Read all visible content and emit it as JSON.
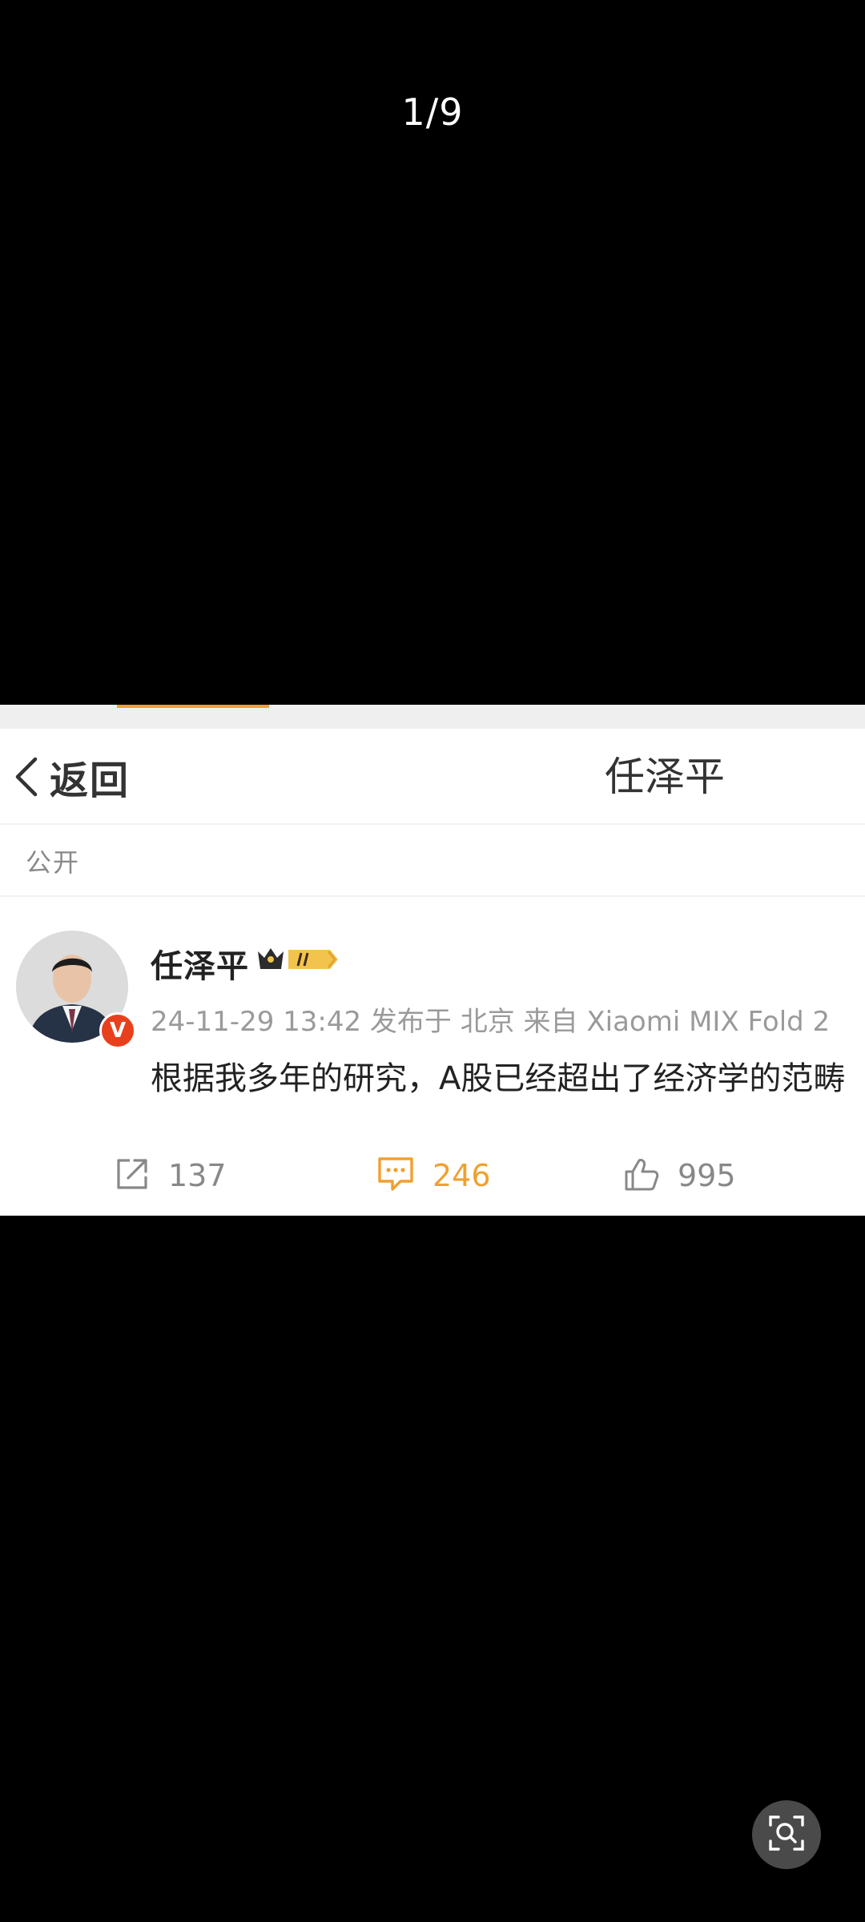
{
  "viewer": {
    "page_counter": "1/9"
  },
  "nav": {
    "back_label": "返回",
    "title": "任泽平"
  },
  "visibility": {
    "label": "公开"
  },
  "post": {
    "author": "任泽平",
    "verified_badge": "V",
    "meta": "24-11-29 13:42 发布于 北京 来自 Xiaomi MIX Fold 2",
    "text": "根据我多年的研究，A股已经超出了经济学的范畴",
    "actions": {
      "repost_count": "137",
      "comment_count": "246",
      "like_count": "995"
    }
  },
  "colors": {
    "accent": "#f0a030",
    "verified": "#e8401c",
    "muted": "#9a9a9a"
  },
  "icons": {
    "back": "chevron-left-icon",
    "repost": "share-icon",
    "comment": "comment-icon",
    "like": "thumbs-up-icon",
    "lens": "image-search-icon",
    "member": "crown-badge-icon"
  }
}
